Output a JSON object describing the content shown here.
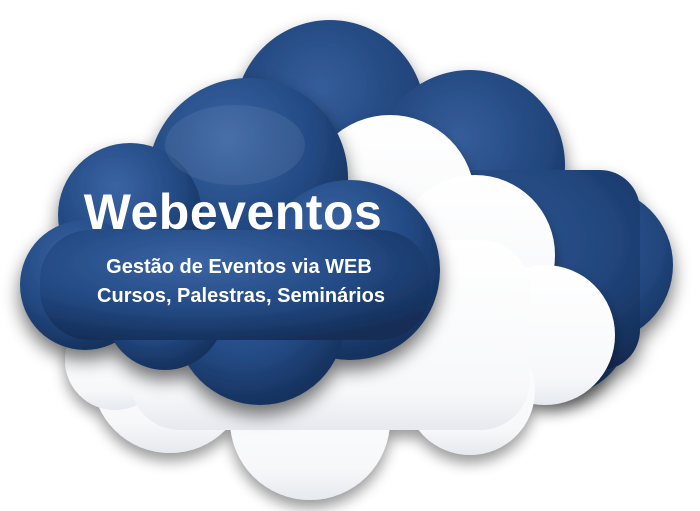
{
  "logo": {
    "title": "Webeventos",
    "line1": "Gestão de Eventos via WEB",
    "line2": "Cursos, Palestras, Seminários"
  },
  "colors": {
    "cloud_blue": "#1f4379",
    "cloud_blue_light": "#3a64a3",
    "cloud_white": "#ffffff",
    "text": "#ffffff"
  }
}
